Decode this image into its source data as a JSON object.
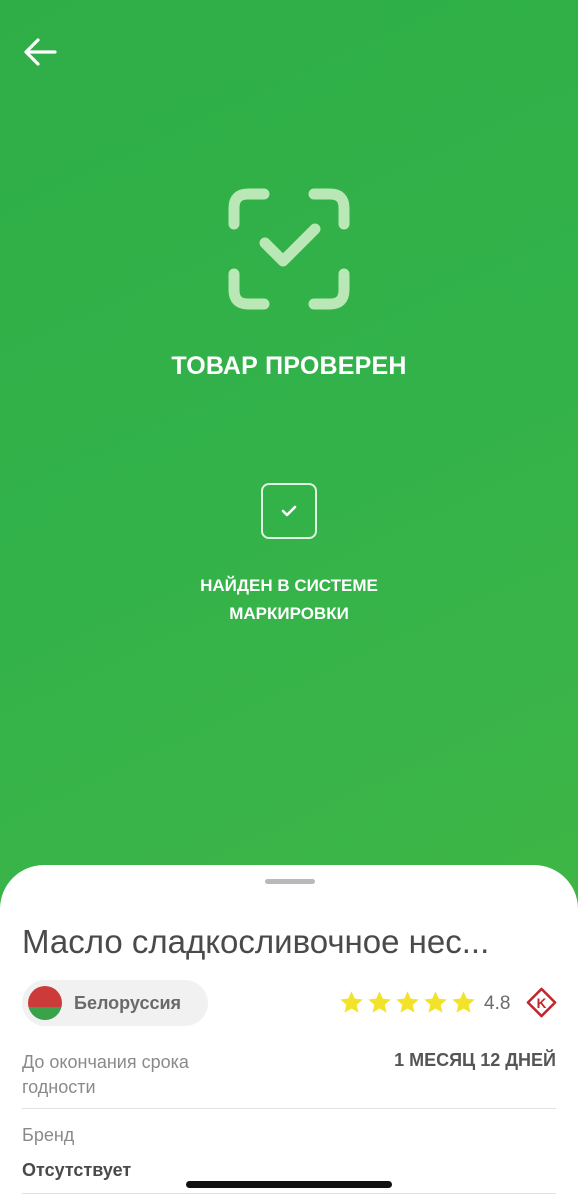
{
  "header": {
    "back_icon": "arrow-left-icon"
  },
  "status": {
    "icon": "scan-check-icon",
    "title": "ТОВАР ПРОВЕРЕН",
    "check_icon": "checkbox-checked-icon",
    "found_text": "НАЙДЕН В СИСТЕМЕ МАРКИРОВКИ"
  },
  "product": {
    "title": "Масло сладкосливочное нес...",
    "country": "Белоруссия",
    "flag_icon": "belarus-flag-icon",
    "rating": "4.8",
    "rating_stars": 5,
    "badge_icon": "k-badge-icon",
    "expiry_label": "До окончания срока годности",
    "expiry_value": "1 МЕСЯЦ 12 ДНЕЙ",
    "brand_label": "Бренд",
    "brand_value": "Отсутствует"
  },
  "colors": {
    "gradient_start": "#2fae47",
    "gradient_end": "#46b83f",
    "star": "#f2e22a",
    "badge": "#c3262c"
  }
}
